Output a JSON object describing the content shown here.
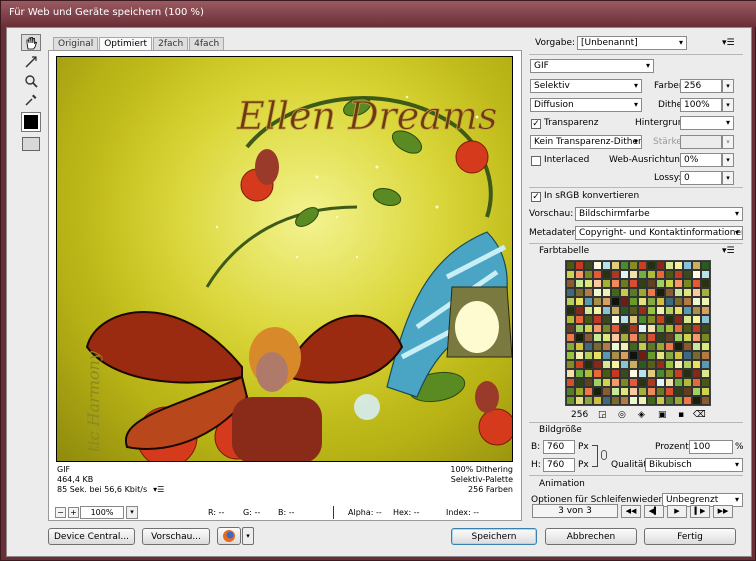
{
  "window": {
    "title": "Für Web und Geräte speichern (100 %)"
  },
  "view_tabs": [
    "Original",
    "Optimiert",
    "2fach",
    "4fach"
  ],
  "image_info": {
    "format": "GIF",
    "size": "464,4 KB",
    "time": "85 Sek. bei 56,6 Kbit/s",
    "dither": "100% Dithering",
    "palette": "Selektiv-Palette",
    "colors": "256 Farben",
    "watermark_title": "Ellen Dreams",
    "watermark_side": "tic Harmony"
  },
  "status": {
    "zoom": "100%",
    "r": "R: --",
    "g": "G: --",
    "b": "B: --",
    "alpha": "Alpha: --",
    "hex": "Hex: --",
    "index": "Index: --"
  },
  "buttons": {
    "device_central": "Device Central...",
    "preview": "Vorschau...",
    "save": "Speichern",
    "cancel": "Abbrechen",
    "done": "Fertig"
  },
  "settings": {
    "preset_label": "Vorgabe:",
    "preset_value": "[Unbenannt]",
    "format": "GIF",
    "reduction": "Selektiv",
    "colors_label": "Farben:",
    "colors_value": "256",
    "dither_algo": "Diffusion",
    "dither_label": "Dither:",
    "dither_value": "100%",
    "transparency_label": "Transparenz",
    "matte_label": "Hintergrund:",
    "transparency_dither": "Kein Transparenz-Dither",
    "amount_label": "Stärke:",
    "interlaced_label": "Interlaced",
    "websnap_label": "Web-Ausrichtung:",
    "websnap_value": "0%",
    "lossy_label": "Lossy:",
    "lossy_value": "0",
    "srgb_label": "In sRGB konvertieren",
    "preview_label": "Vorschau:",
    "preview_value": "Bildschirmfarbe",
    "metadata_label": "Metadaten:",
    "metadata_value": "Copyright- und Kontaktinformationen"
  },
  "color_table": {
    "title": "Farbtabelle",
    "count": "256",
    "palette": [
      "#4a5a12",
      "#7a8a22",
      "#a4b03a",
      "#c9c94a",
      "#e6e080",
      "#f2efb0",
      "#8a2818",
      "#c23a22",
      "#e45a36",
      "#f08a5a",
      "#5a7a2a",
      "#86a83e",
      "#b6d060",
      "#d8e890",
      "#3a4a1a",
      "#2a3210",
      "#6e7a20",
      "#9aaa2c",
      "#d0c040",
      "#eae060",
      "#f6f2a0",
      "#fffbe0",
      "#a83a20",
      "#d65030",
      "#f07848",
      "#3e6a80",
      "#5a9ab0",
      "#8ac4d4",
      "#b8e2ea",
      "#e0f4f8",
      "#304018",
      "#1a2008",
      "#7a6a30",
      "#a89048",
      "#c8b060",
      "#e0cc80",
      "#f0e2a8",
      "#604020",
      "#8a5a30",
      "#b47a44",
      "#d8a060",
      "#2a5a20",
      "#4a8a30",
      "#72b040",
      "#a0d060",
      "#c8e898",
      "#ecf8d0",
      "#101408",
      "#585e18",
      "#848c24",
      "#aebc34",
      "#ccd44c",
      "#dce87a",
      "#eef2b2",
      "#701c10",
      "#9c2a18",
      "#c84020",
      "#e86838",
      "#f89868",
      "#fcc8a0",
      "#406818",
      "#6a9a28",
      "#98c43c",
      "#223010"
    ],
    "tools": [
      "◲",
      "◎",
      "◈",
      "▣",
      "▪",
      "⌫"
    ]
  },
  "image_size": {
    "title": "Bildgröße",
    "width_label": "B:",
    "width_value": "760",
    "height_label": "H:",
    "height_value": "760",
    "unit": "Px",
    "percent_label": "Prozent:",
    "percent_value": "100",
    "percent_unit": "%",
    "quality_label": "Qualität:",
    "quality_value": "Bikubisch"
  },
  "animation": {
    "title": "Animation",
    "loop_label": "Optionen für Schleifenwiedergabe:",
    "loop_value": "Unbegrenzt",
    "frame_counter": "3 von 3"
  }
}
